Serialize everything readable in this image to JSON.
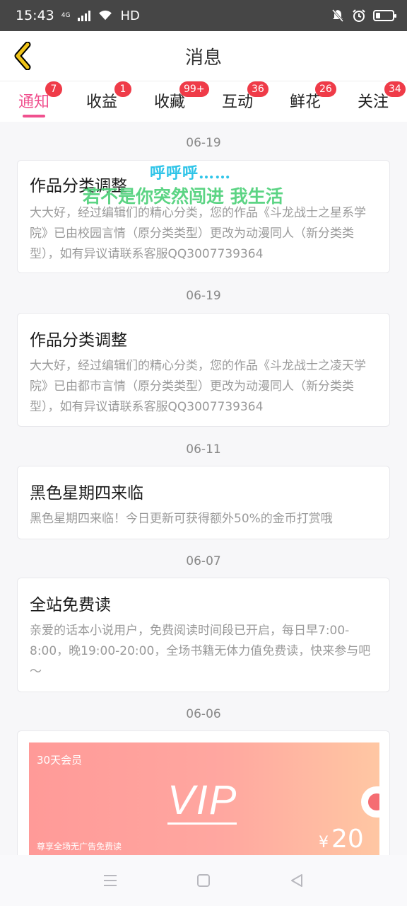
{
  "status_bar": {
    "time": "15:43",
    "network": "4G",
    "hd": "HD"
  },
  "header": {
    "title": "消息"
  },
  "tabs": [
    {
      "label": "通知",
      "badge": "7",
      "active": true
    },
    {
      "label": "收益",
      "badge": "1"
    },
    {
      "label": "收藏",
      "badge": "99+"
    },
    {
      "label": "互动",
      "badge": "36"
    },
    {
      "label": "鲜花",
      "badge": "26"
    },
    {
      "label": "关注",
      "badge": "34"
    }
  ],
  "overlay": {
    "line1": "呼呼呼……",
    "line2": "若不是你突然闯进 我生活"
  },
  "messages": [
    {
      "date": "06-19",
      "title": "作品分类调整",
      "body": "大大好，经过编辑们的精心分类，您的作品《斗龙战士之星系学院》已由校园言情（原分类类型）更改为动漫同人（新分类类型），如有异议请联系客服QQ3007739364"
    },
    {
      "date": "06-19",
      "title": "作品分类调整",
      "body": "大大好，经过编辑们的精心分类，您的作品《斗龙战士之凌天学院》已由都市言情（原分类类型）更改为动漫同人（新分类类型），如有异议请联系客服QQ3007739364"
    },
    {
      "date": "06-11",
      "title": "黑色星期四来临",
      "body": "黑色星期四来临！今日更新可获得额外50%的金币打赏哦"
    },
    {
      "date": "06-07",
      "title": "全站免费读",
      "body": "亲爱的话本小说用户，免费阅读时间段已开启，每日早7:00-8:00，晚19:00-20:00，全场书籍无体力值免费读，快来参与吧～"
    },
    {
      "date": "06-06"
    }
  ],
  "vip_card": {
    "days": "30天会员",
    "vip": "VIP",
    "desc": "尊享全场无广告免费读",
    "currency": "¥",
    "price": "20"
  },
  "colors": {
    "accent": "#f0508e",
    "badge": "#ef3b48",
    "status_bar": "#464646",
    "back_arrow": "#f0c419"
  }
}
